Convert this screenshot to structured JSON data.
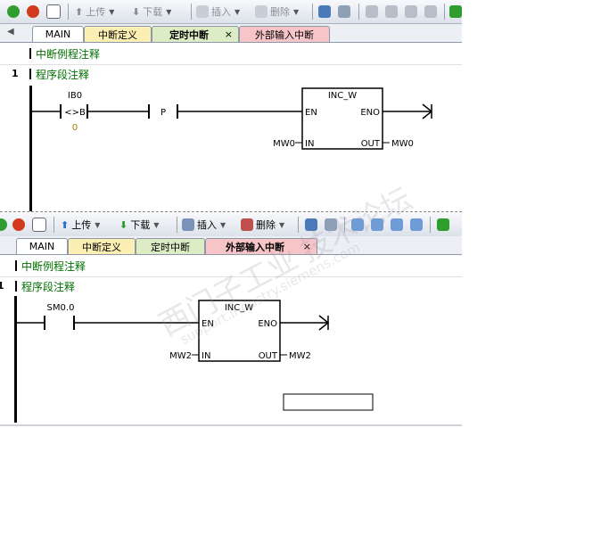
{
  "toolbar": {
    "upload_label": "上传",
    "download_label": "下载",
    "insert_label": "插入",
    "delete_label": "删除"
  },
  "tabs": [
    "MAIN",
    "中断定义",
    "定时中断",
    "外部输入中断"
  ],
  "close_glyph": "×",
  "panel1": {
    "program_comment": "中断例程注释",
    "network_number": "1",
    "network_comment": "程序段注释",
    "contact1_address": "IB0",
    "contact1_operator": "<>B",
    "contact1_value": "0",
    "contact2_label": "P",
    "box_title": "INC_W",
    "en": "EN",
    "eno": "ENO",
    "in_pin": "IN",
    "out_pin": "OUT",
    "in_operand": "MW0",
    "out_operand": "MW0"
  },
  "panel2": {
    "program_comment": "中断例程注释",
    "network_comment": "程序段注释",
    "contact_address": "SM0.0",
    "box_title": "INC_W",
    "en": "EN",
    "eno": "ENO",
    "in_pin": "IN",
    "out_pin": "OUT",
    "in_operand": "MW2",
    "out_operand": "MW2"
  },
  "watermark": {
    "line1": "西门子工业",
    "line2": "support.industry.siemens.com",
    "line3": "技术论坛"
  },
  "colors": {
    "comment_green": "#007000",
    "tab_yellow": "#fbefb4",
    "tab_green": "#dcecc4",
    "tab_pink": "#f7c5c8"
  }
}
